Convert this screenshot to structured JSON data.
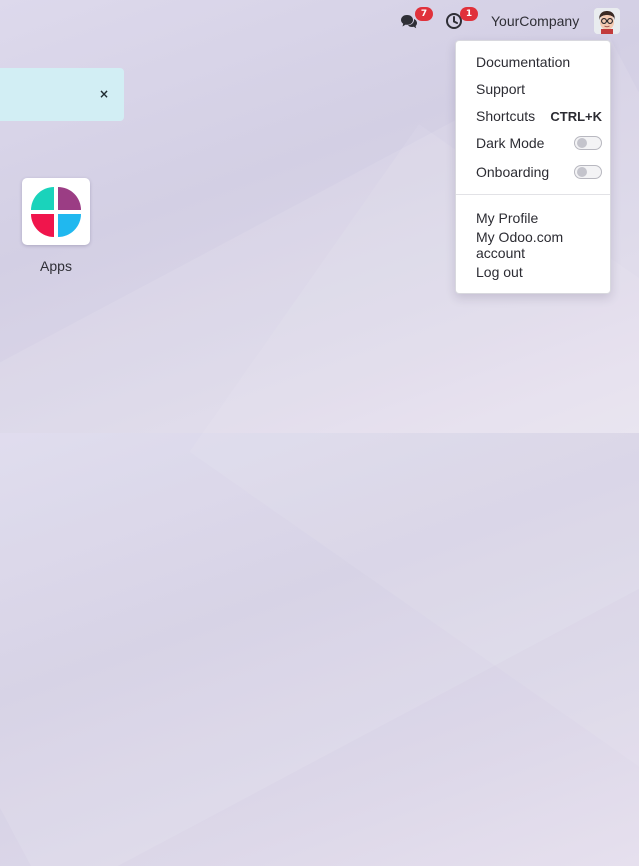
{
  "systray": {
    "messages": {
      "icon": "chat-icon",
      "count": "7"
    },
    "activities": {
      "icon": "clock-icon",
      "count": "1"
    },
    "company_name": "YourCompany",
    "user_avatar": "user-avatar"
  },
  "banner": {
    "close_label": "×"
  },
  "apps": [
    {
      "label": "Apps",
      "icon": "apps-icon"
    }
  ],
  "user_menu": {
    "items": [
      {
        "label": "Documentation"
      },
      {
        "label": "Support"
      },
      {
        "label": "Shortcuts",
        "shortcut": "CTRL+K"
      },
      {
        "label": "Dark Mode",
        "toggle": false
      },
      {
        "label": "Onboarding",
        "toggle": false
      },
      {
        "label": "My Profile"
      },
      {
        "label": "My Odoo.com account"
      },
      {
        "label": "Log out"
      }
    ]
  },
  "colors": {
    "badge": "#e0313b",
    "banner": "#d2eef4",
    "apps_icon": [
      "#1ad3bb",
      "#9b3d84",
      "#f0154c",
      "#20b8ef"
    ]
  }
}
